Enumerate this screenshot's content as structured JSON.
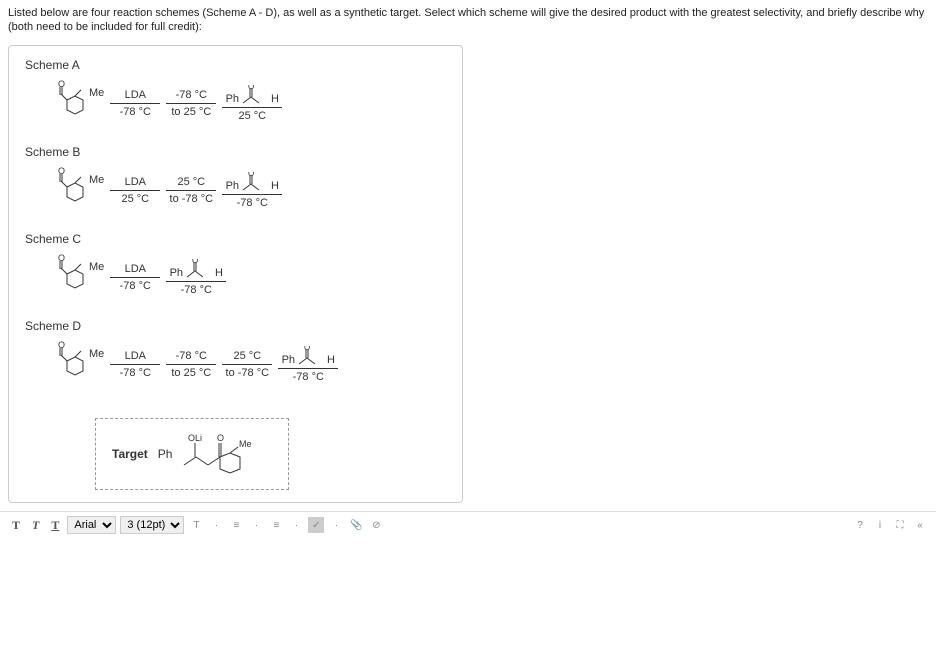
{
  "question": "Listed below are four reaction schemes (Scheme A - D), as well as a synthetic target. Select which scheme will give the desired product with the greatest selectivity, and briefly describe why (both need to be included for full credit):",
  "schemeA": {
    "title": "Scheme A",
    "me": "Me",
    "step1_top": "LDA",
    "step1_bot": "-78 °C",
    "step2_top": "-78 °C",
    "step2_bot": "to 25 °C",
    "ph": "Ph",
    "h": "H",
    "step3_bot": "25 °C"
  },
  "schemeB": {
    "title": "Scheme B",
    "me": "Me",
    "step1_top": "LDA",
    "step1_bot": "25 °C",
    "step2_top": "25 °C",
    "step2_bot": "to -78 °C",
    "ph": "Ph",
    "h": "H",
    "step3_bot": "-78 °C"
  },
  "schemeC": {
    "title": "Scheme C",
    "me": "Me",
    "step1_top": "LDA",
    "step1_bot": "-78 °C",
    "ph": "Ph",
    "h": "H",
    "step2_bot": "-78 °C"
  },
  "schemeD": {
    "title": "Scheme D",
    "me": "Me",
    "step1_top": "LDA",
    "step1_bot": "-78 °C",
    "step2_top": "-78 °C",
    "step2_bot": "to 25 °C",
    "step3_top": "25 °C",
    "step3_bot": "to -78 °C",
    "ph": "Ph",
    "h": "H",
    "step4_bot": "-78 °C"
  },
  "target": {
    "label": "Target",
    "oli": "OLi",
    "o": "O",
    "ph": "Ph",
    "me": "Me"
  },
  "toolbar": {
    "bold": "T",
    "italic": "T",
    "underline": "T",
    "font": "Arial",
    "size": "3 (12pt)"
  }
}
